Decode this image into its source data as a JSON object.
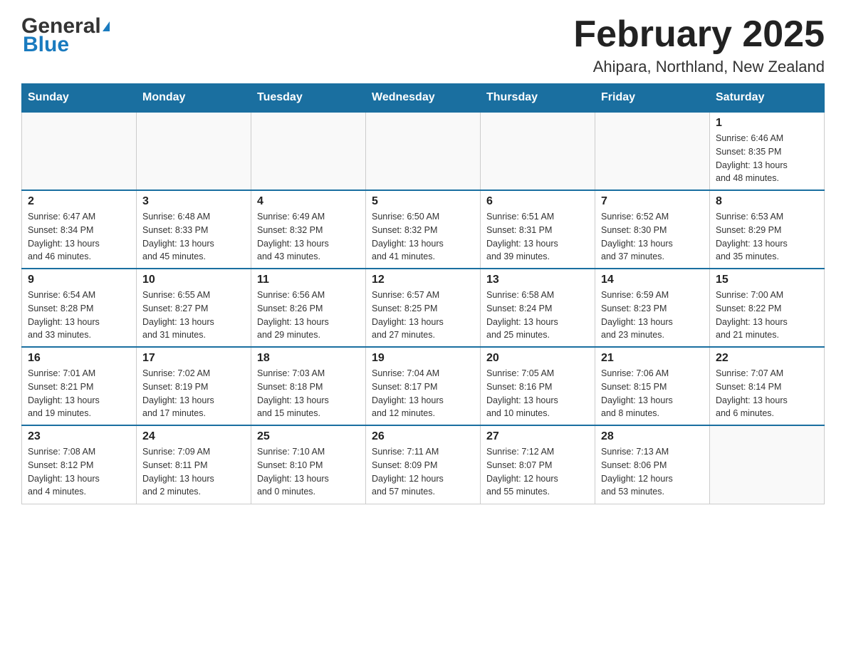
{
  "header": {
    "logo_general": "General",
    "logo_blue": "Blue",
    "month_title": "February 2025",
    "location": "Ahipara, Northland, New Zealand"
  },
  "weekdays": [
    "Sunday",
    "Monday",
    "Tuesday",
    "Wednesday",
    "Thursday",
    "Friday",
    "Saturday"
  ],
  "weeks": [
    [
      {
        "day": "",
        "info": ""
      },
      {
        "day": "",
        "info": ""
      },
      {
        "day": "",
        "info": ""
      },
      {
        "day": "",
        "info": ""
      },
      {
        "day": "",
        "info": ""
      },
      {
        "day": "",
        "info": ""
      },
      {
        "day": "1",
        "info": "Sunrise: 6:46 AM\nSunset: 8:35 PM\nDaylight: 13 hours\nand 48 minutes."
      }
    ],
    [
      {
        "day": "2",
        "info": "Sunrise: 6:47 AM\nSunset: 8:34 PM\nDaylight: 13 hours\nand 46 minutes."
      },
      {
        "day": "3",
        "info": "Sunrise: 6:48 AM\nSunset: 8:33 PM\nDaylight: 13 hours\nand 45 minutes."
      },
      {
        "day": "4",
        "info": "Sunrise: 6:49 AM\nSunset: 8:32 PM\nDaylight: 13 hours\nand 43 minutes."
      },
      {
        "day": "5",
        "info": "Sunrise: 6:50 AM\nSunset: 8:32 PM\nDaylight: 13 hours\nand 41 minutes."
      },
      {
        "day": "6",
        "info": "Sunrise: 6:51 AM\nSunset: 8:31 PM\nDaylight: 13 hours\nand 39 minutes."
      },
      {
        "day": "7",
        "info": "Sunrise: 6:52 AM\nSunset: 8:30 PM\nDaylight: 13 hours\nand 37 minutes."
      },
      {
        "day": "8",
        "info": "Sunrise: 6:53 AM\nSunset: 8:29 PM\nDaylight: 13 hours\nand 35 minutes."
      }
    ],
    [
      {
        "day": "9",
        "info": "Sunrise: 6:54 AM\nSunset: 8:28 PM\nDaylight: 13 hours\nand 33 minutes."
      },
      {
        "day": "10",
        "info": "Sunrise: 6:55 AM\nSunset: 8:27 PM\nDaylight: 13 hours\nand 31 minutes."
      },
      {
        "day": "11",
        "info": "Sunrise: 6:56 AM\nSunset: 8:26 PM\nDaylight: 13 hours\nand 29 minutes."
      },
      {
        "day": "12",
        "info": "Sunrise: 6:57 AM\nSunset: 8:25 PM\nDaylight: 13 hours\nand 27 minutes."
      },
      {
        "day": "13",
        "info": "Sunrise: 6:58 AM\nSunset: 8:24 PM\nDaylight: 13 hours\nand 25 minutes."
      },
      {
        "day": "14",
        "info": "Sunrise: 6:59 AM\nSunset: 8:23 PM\nDaylight: 13 hours\nand 23 minutes."
      },
      {
        "day": "15",
        "info": "Sunrise: 7:00 AM\nSunset: 8:22 PM\nDaylight: 13 hours\nand 21 minutes."
      }
    ],
    [
      {
        "day": "16",
        "info": "Sunrise: 7:01 AM\nSunset: 8:21 PM\nDaylight: 13 hours\nand 19 minutes."
      },
      {
        "day": "17",
        "info": "Sunrise: 7:02 AM\nSunset: 8:19 PM\nDaylight: 13 hours\nand 17 minutes."
      },
      {
        "day": "18",
        "info": "Sunrise: 7:03 AM\nSunset: 8:18 PM\nDaylight: 13 hours\nand 15 minutes."
      },
      {
        "day": "19",
        "info": "Sunrise: 7:04 AM\nSunset: 8:17 PM\nDaylight: 13 hours\nand 12 minutes."
      },
      {
        "day": "20",
        "info": "Sunrise: 7:05 AM\nSunset: 8:16 PM\nDaylight: 13 hours\nand 10 minutes."
      },
      {
        "day": "21",
        "info": "Sunrise: 7:06 AM\nSunset: 8:15 PM\nDaylight: 13 hours\nand 8 minutes."
      },
      {
        "day": "22",
        "info": "Sunrise: 7:07 AM\nSunset: 8:14 PM\nDaylight: 13 hours\nand 6 minutes."
      }
    ],
    [
      {
        "day": "23",
        "info": "Sunrise: 7:08 AM\nSunset: 8:12 PM\nDaylight: 13 hours\nand 4 minutes."
      },
      {
        "day": "24",
        "info": "Sunrise: 7:09 AM\nSunset: 8:11 PM\nDaylight: 13 hours\nand 2 minutes."
      },
      {
        "day": "25",
        "info": "Sunrise: 7:10 AM\nSunset: 8:10 PM\nDaylight: 13 hours\nand 0 minutes."
      },
      {
        "day": "26",
        "info": "Sunrise: 7:11 AM\nSunset: 8:09 PM\nDaylight: 12 hours\nand 57 minutes."
      },
      {
        "day": "27",
        "info": "Sunrise: 7:12 AM\nSunset: 8:07 PM\nDaylight: 12 hours\nand 55 minutes."
      },
      {
        "day": "28",
        "info": "Sunrise: 7:13 AM\nSunset: 8:06 PM\nDaylight: 12 hours\nand 53 minutes."
      },
      {
        "day": "",
        "info": ""
      }
    ]
  ]
}
